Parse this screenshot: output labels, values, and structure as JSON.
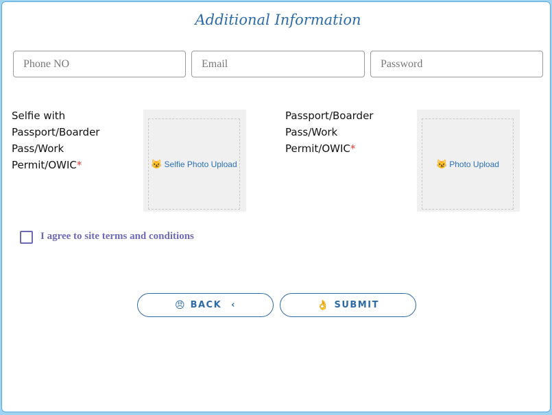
{
  "form": {
    "title": "Additional Information",
    "fields": {
      "phone_placeholder": "Phone NO",
      "email_placeholder": "Email",
      "password_placeholder": "Password"
    },
    "selfie": {
      "label_lines": [
        "Selfie with",
        "Passport/Boarder",
        "Pass/Work",
        "Permit/OWIC"
      ],
      "required_mark": "*",
      "upload_icon": "😼",
      "upload_text": "Selfie Photo Upload"
    },
    "passport": {
      "label_lines": [
        "Passport/Boarder",
        "Pass/Work",
        "Permit/OWIC"
      ],
      "required_mark": "*",
      "upload_icon": "😼",
      "upload_text": "Photo Upload"
    },
    "terms": {
      "label": "I agree to site terms and conditions"
    },
    "buttons": {
      "back_icon": "😠",
      "back_label": "BACK",
      "back_chevron": "‹",
      "submit_icon": "👌",
      "submit_label": "SUBMIT"
    }
  },
  "colors": {
    "accent": "#2d6aa8",
    "terms": "#6e68b8",
    "required": "#e53935",
    "border": "#5aa9e0"
  }
}
